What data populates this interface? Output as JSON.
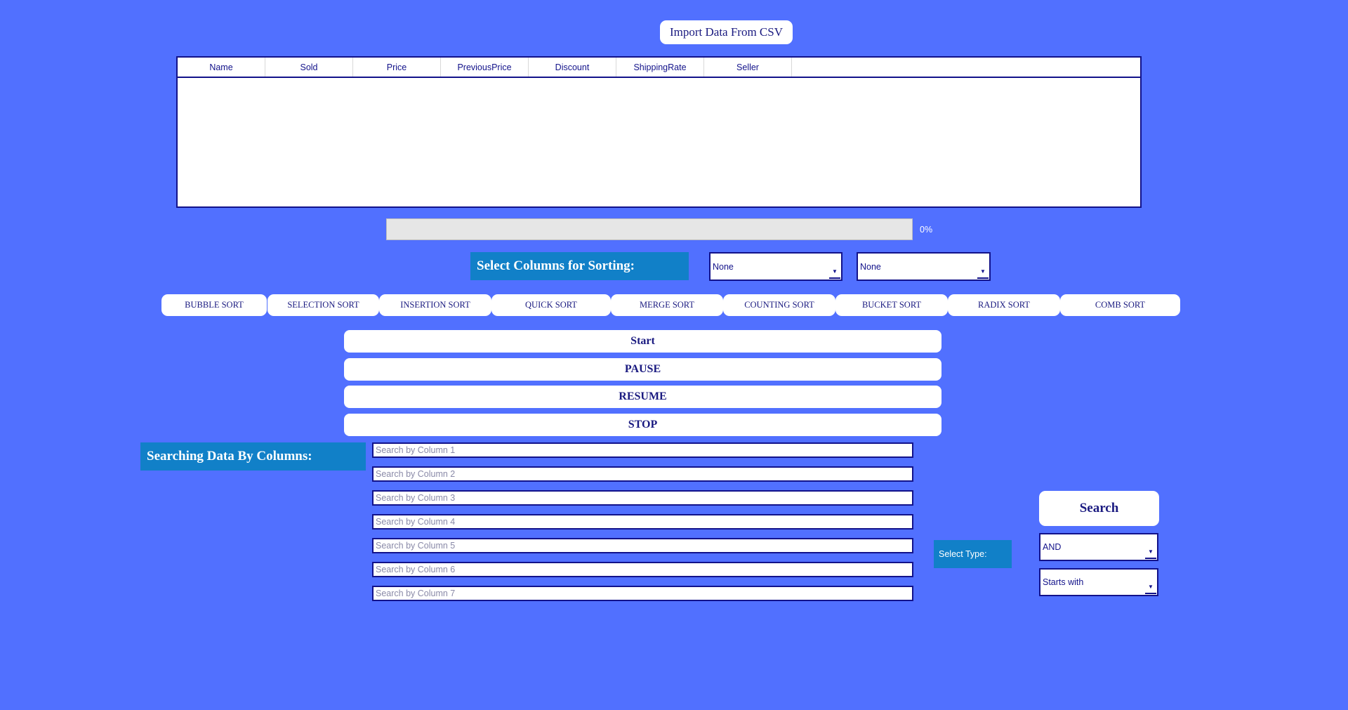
{
  "import": {
    "label": "Import Data From CSV"
  },
  "table": {
    "columns": [
      "Name",
      "Sold",
      "Price",
      "PreviousPrice",
      "Discount",
      "ShippingRate",
      "Seller"
    ],
    "rows": []
  },
  "progress": {
    "value": 0,
    "text": "0%"
  },
  "sorting": {
    "label": "Select Columns for Sorting:",
    "column_a": "None",
    "column_b": "None",
    "algorithms": [
      "BUBBLE SORT",
      "SELECTION SORT",
      "INSERTION SORT",
      "QUICK SORT",
      "MERGE SORT",
      "COUNTING SORT",
      "BUCKET SORT",
      "RADIX SORT",
      "COMB SORT"
    ]
  },
  "controls": {
    "start": "Start",
    "pause": "PAUSE",
    "resume": "RESUME",
    "stop": "STOP"
  },
  "search": {
    "label": "Searching Data By Columns:",
    "placeholders": [
      "Search by Column 1",
      "Search by Column 2",
      "Search by Column 3",
      "Search by Column 4",
      "Search by Column 5",
      "Search by Column 6",
      "Search by Column 7"
    ],
    "button": "Search",
    "type_label": "Select Type:",
    "logic": "AND",
    "match": "Starts with"
  },
  "colors": {
    "background": "#5170ff",
    "accent": "#1180c8",
    "text": "#1a1a80"
  },
  "icons": {
    "combo_arrow": "chevron-down-icon"
  }
}
